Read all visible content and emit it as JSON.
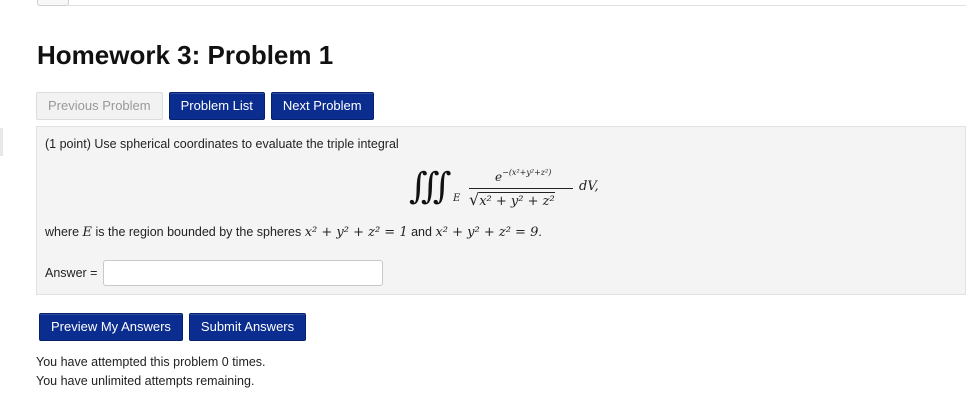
{
  "page": {
    "title": "Homework 3: Problem 1"
  },
  "nav": {
    "previous_label": "Previous Problem",
    "list_label": "Problem List",
    "next_label": "Next Problem"
  },
  "problem": {
    "intro": "(1 point) Use spherical coordinates to evaluate the triple integral",
    "integral": {
      "sign": "∭",
      "region": "E",
      "numerator_base": "e",
      "numerator_exponent": "−(x²+y²+z²)",
      "denominator": "x² + y² + z²",
      "differential": "dV,"
    },
    "where_prefix": "where",
    "where_var": "E",
    "where_mid": "is the region bounded by the spheres",
    "sphere1": "x² + y² + z² = 1",
    "and_word": "and",
    "sphere2": "x² + y² + z² = 9",
    "end_punct": "."
  },
  "answer": {
    "label": "Answer =",
    "value": "",
    "placeholder": ""
  },
  "actions": {
    "preview_label": "Preview My Answers",
    "submit_label": "Submit Answers"
  },
  "status": {
    "attempts": "You have attempted this problem 0 times.",
    "remaining": "You have unlimited attempts remaining."
  },
  "colors": {
    "primary_button": "#0b2d8f",
    "problem_box_bg": "#f4f4f4"
  }
}
